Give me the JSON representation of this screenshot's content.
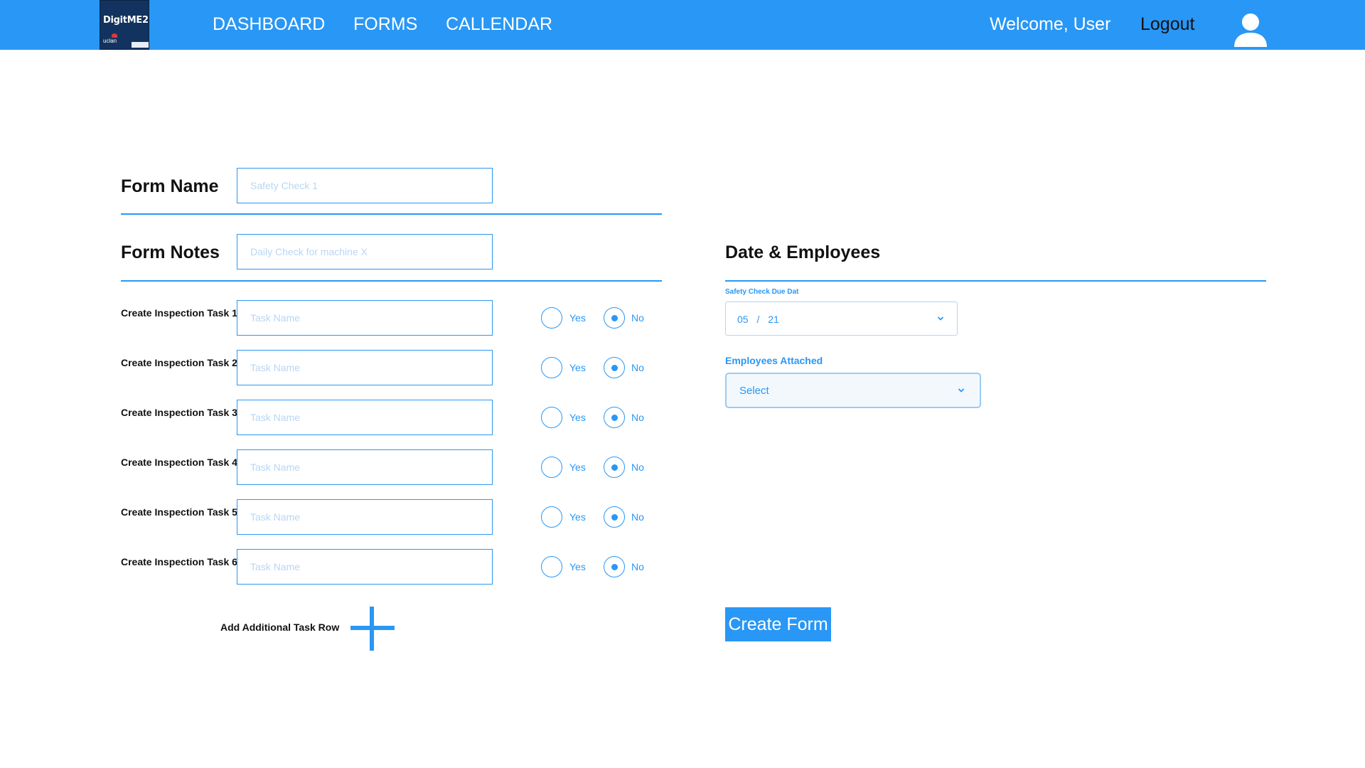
{
  "header": {
    "logo_text": "DigitME2",
    "logo_sub": "uclan",
    "nav": [
      {
        "label": "DASHBOARD"
      },
      {
        "label": "FORMS"
      },
      {
        "label": "CALLENDAR"
      }
    ],
    "welcome": "Welcome, User",
    "logout": "Logout",
    "user_icon": "user-icon"
  },
  "form": {
    "name_label": "Form Name",
    "name_placeholder": "Safety Check 1",
    "notes_label": "Form Notes",
    "notes_placeholder": "Daily Check for machine X",
    "tasks": [
      {
        "label": "Create Inspection Task 1",
        "placeholder": "Task Name",
        "yes": "Yes",
        "no": "No",
        "selected": "No"
      },
      {
        "label": "Create Inspection Task 2",
        "placeholder": "Task Name",
        "yes": "Yes",
        "no": "No",
        "selected": "No"
      },
      {
        "label": "Create Inspection Task 3",
        "placeholder": "Task Name",
        "yes": "Yes",
        "no": "No",
        "selected": "No"
      },
      {
        "label": "Create Inspection Task 4",
        "placeholder": "Task Name",
        "yes": "Yes",
        "no": "No",
        "selected": "No"
      },
      {
        "label": "Create Inspection Task 5",
        "placeholder": "Task Name",
        "yes": "Yes",
        "no": "No",
        "selected": "No"
      },
      {
        "label": "Create Inspection Task 6",
        "placeholder": "Task Name",
        "yes": "Yes",
        "no": "No",
        "selected": "No"
      }
    ],
    "add_row_label": "Add Additional Task Row",
    "add_icon": "plus-icon"
  },
  "side": {
    "title": "Date & Employees",
    "due_label": "Safety Check Due Dat",
    "due_month": "05",
    "due_sep": "/",
    "due_day": "21",
    "employees_label": "Employees Attached",
    "employees_value": "Select",
    "create_button": "Create Form"
  },
  "colors": {
    "primary": "#2997f5",
    "logo_bg": "#12335f",
    "placeholder": "#b9d6f3"
  }
}
